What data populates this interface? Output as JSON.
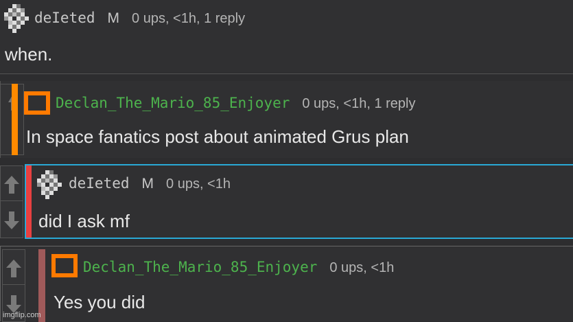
{
  "comments": [
    {
      "username": "deIeted",
      "badge": "M",
      "meta": "0 ups, <1h, 1 reply",
      "text": "when.",
      "username_color": "#c8c8c8",
      "avatar": "deleted-checker-icon"
    },
    {
      "username": "Declan_The_Mario_85_Enjoyer",
      "meta": "0 ups, <1h, 1 reply",
      "text": "In space fanatics post about animated Grus plan",
      "username_color": "#4db34d",
      "accent_color": "#ff8a00",
      "avatar": "orange-square-icon"
    },
    {
      "username": "deIeted",
      "badge": "M",
      "meta": "0 ups, <1h",
      "text": "did I ask mf",
      "username_color": "#c8c8c8",
      "accent_color": "#e84040",
      "border_color": "#29a9d6",
      "avatar": "deleted-checker-icon"
    },
    {
      "username": "Declan_The_Mario_85_Enjoyer",
      "meta": "0 ups, <1h",
      "text": "Yes you did",
      "username_color": "#4db34d",
      "accent_color": "#a05a5a",
      "avatar": "orange-square-icon"
    }
  ],
  "icons": {
    "upvote": "arrow-up-icon",
    "downvote": "arrow-down-icon"
  },
  "watermark": "imgflip.com"
}
